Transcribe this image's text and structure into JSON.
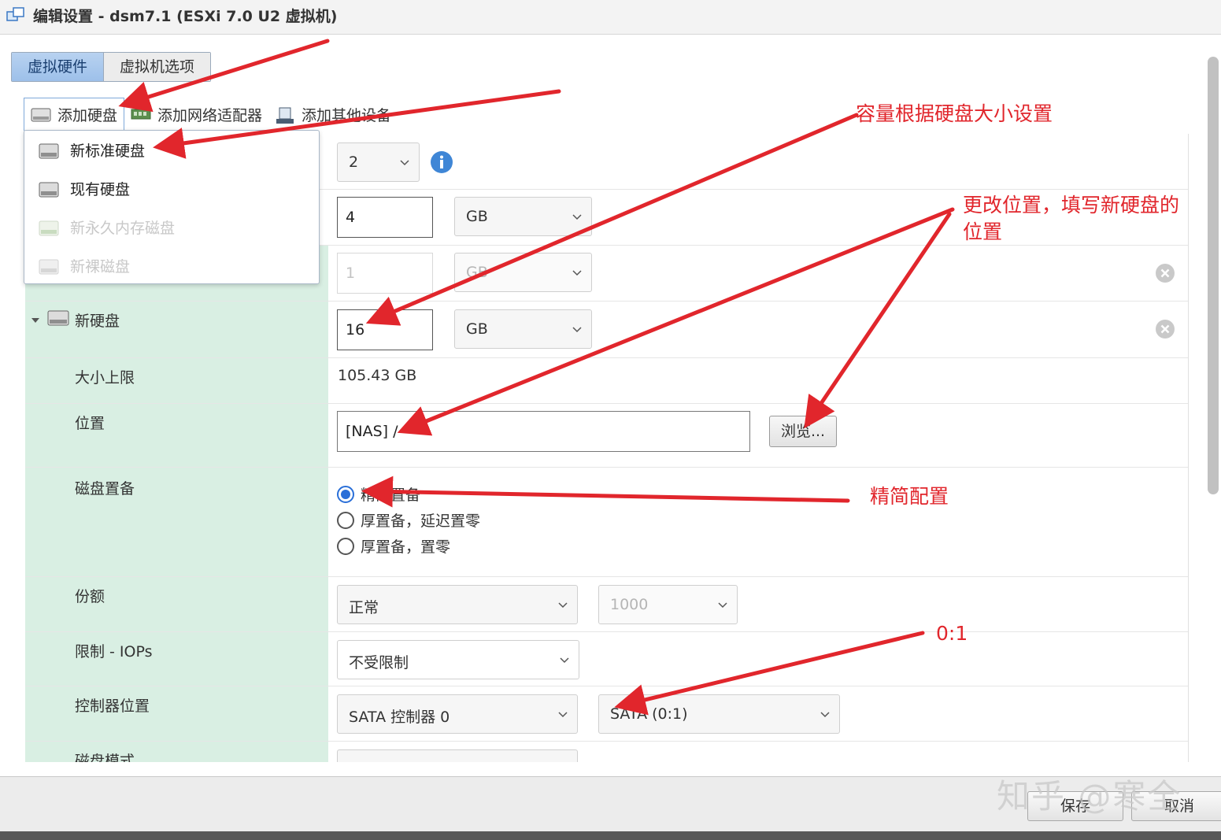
{
  "window": {
    "title": "编辑设置 - dsm7.1 (ESXi 7.0 U2 虚拟机)",
    "icon": "vm-icon"
  },
  "tabs": [
    {
      "label": "虚拟硬件",
      "active": true
    },
    {
      "label": "虚拟机选项",
      "active": false
    }
  ],
  "toolbar": {
    "add_disk": "添加硬盘",
    "add_network": "添加网络适配器",
    "add_other": "添加其他设备"
  },
  "add_disk_menu": [
    {
      "label": "新标准硬盘",
      "enabled": true
    },
    {
      "label": "现有硬盘",
      "enabled": true
    },
    {
      "label": "新永久内存磁盘",
      "enabled": false
    },
    {
      "label": "新裸磁盘",
      "enabled": false
    }
  ],
  "rows": {
    "cpu": {
      "value": "2"
    },
    "memory": {
      "value": "4",
      "unit": "GB"
    },
    "hard_disk_1": {
      "value": "1",
      "unit": "GB"
    },
    "new_disk": {
      "label": "新硬盘",
      "value": "16",
      "unit": "GB"
    },
    "max_size": {
      "label": "大小上限",
      "value": "105.43 GB"
    },
    "location": {
      "label": "位置",
      "value": "[NAS] /",
      "browse": "浏览..."
    },
    "provisioning": {
      "label": "磁盘置备",
      "options": [
        {
          "label": "精简置备",
          "selected": true
        },
        {
          "label": "厚置备，延迟置零",
          "selected": false
        },
        {
          "label": "厚置备，置零",
          "selected": false
        }
      ]
    },
    "shares": {
      "label": "份额",
      "value": "正常",
      "number": "1000"
    },
    "limit_iops": {
      "label": "限制 - IOPs",
      "value": "不受限制"
    },
    "controller": {
      "label": "控制器位置",
      "controller": "SATA 控制器 0",
      "slot": "SATA (0:1)"
    },
    "disk_mode": {
      "label": "磁盘模式"
    }
  },
  "footer": {
    "save": "保存",
    "cancel": "取消"
  },
  "annotations": {
    "capacity": "容量根据硬盘大小设置",
    "location_line1": "更改位置，填写新硬盘的",
    "location_line2": "位置",
    "thin": "精简配置",
    "slot": "0:1"
  },
  "watermark": "知乎 @寒全",
  "colors": {
    "annotation_red": "#e1262c",
    "label_bg": "#d9efe3",
    "accent_blue": "#2a6fd8"
  }
}
